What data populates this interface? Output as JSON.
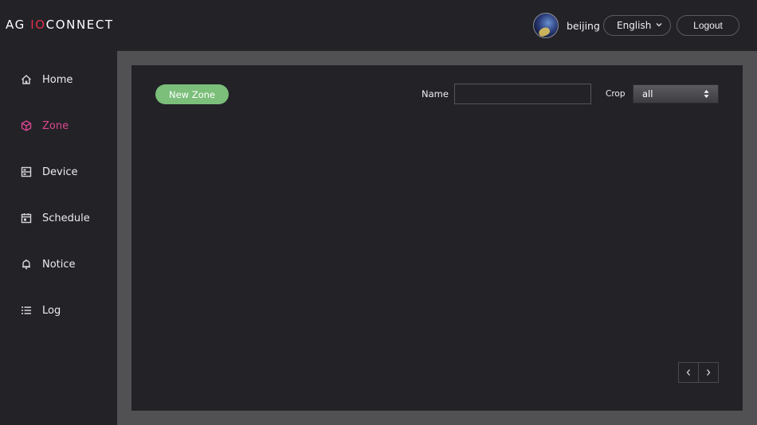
{
  "header": {
    "logo_prefix": "AG ",
    "logo_accent": "IO",
    "logo_suffix": "CONNECT",
    "username": "beijing",
    "language": "English",
    "logout_label": "Logout"
  },
  "sidebar": {
    "items": [
      {
        "label": "Home",
        "icon": "home-icon",
        "active": false
      },
      {
        "label": "Zone",
        "icon": "cube-icon",
        "active": true
      },
      {
        "label": "Device",
        "icon": "device-icon",
        "active": false
      },
      {
        "label": "Schedule",
        "icon": "calendar-icon",
        "active": false
      },
      {
        "label": "Notice",
        "icon": "bell-icon",
        "active": false
      },
      {
        "label": "Log",
        "icon": "list-icon",
        "active": false
      }
    ]
  },
  "toolbar": {
    "new_zone_label": "New Zone",
    "name_label": "Name",
    "name_value": "",
    "crop_label": "Crop",
    "crop_selected": "all"
  },
  "pagination": {
    "prev_icon": "chevron-left-icon",
    "next_icon": "chevron-right-icon"
  },
  "colors": {
    "accent_active": "#d9478f",
    "logo_accent": "#e0304a",
    "primary_button": "#7bbf7a",
    "frame": "#515153",
    "panel": "#232227"
  }
}
